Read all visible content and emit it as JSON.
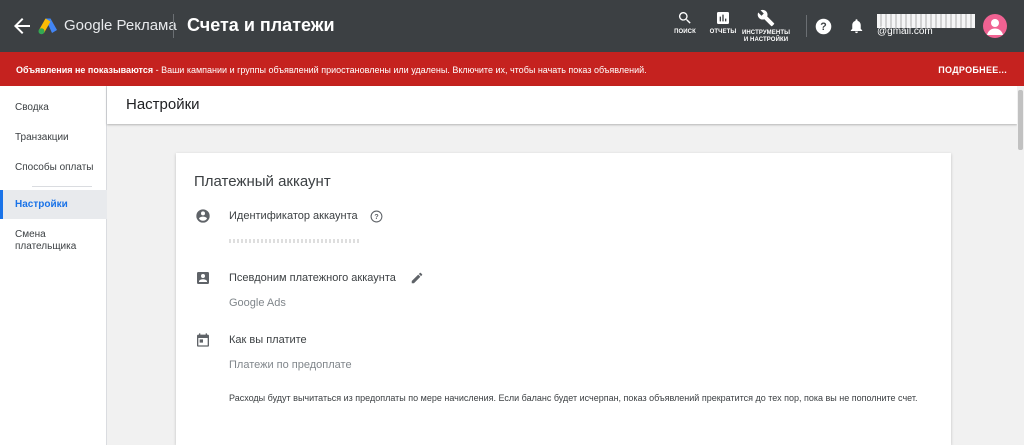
{
  "header": {
    "brand": "Google Реклама",
    "title": "Счета и платежи",
    "tools": {
      "search": "ПОИСК",
      "reports": "ОТЧЕТЫ",
      "tools_line1": "ИНСТРУМЕНТЫ",
      "tools_line2": "И НАСТРОЙКИ"
    },
    "email": "@gmail.com"
  },
  "alert": {
    "bold": "Объявления не показываются",
    "text": " - Ваши кампании и группы объявлений приостановлены или удалены. Включите их, чтобы начать показ объявлений.",
    "more": "ПОДРОБНЕЕ..."
  },
  "sidebar": {
    "items": [
      {
        "label": "Сводка"
      },
      {
        "label": "Транзакции"
      },
      {
        "label": "Способы оплаты"
      },
      {
        "label": "Настройки"
      },
      {
        "label": "Смена плательщика"
      }
    ]
  },
  "main": {
    "page_title": "Настройки",
    "card": {
      "title": "Платежный аккаунт",
      "account_id_label": "Идентификатор аккаунта",
      "alias_label": "Псевдоним платежного аккаунта",
      "alias_value": "Google Ads",
      "how_you_pay_label": "Как вы платите",
      "how_you_pay_value": "Платежи по предоплате",
      "description": "Расходы будут вычитаться из предоплаты по мере начисления. Если баланс будет исчерпан, показ объявлений прекратится до тех пор, пока вы не пополните счет."
    }
  },
  "colors": {
    "topbar": "#3c4043",
    "alert": "#c5221f",
    "accent": "#1a73e8",
    "avatar": "#f06292"
  },
  "icons": [
    "back-arrow-icon",
    "google-ads-logo-icon",
    "search-icon",
    "reports-icon",
    "wrench-icon",
    "help-icon",
    "bell-icon",
    "avatar-icon",
    "account-circle-icon",
    "help-circle-icon",
    "contact-card-icon",
    "pencil-icon",
    "calendar-icon"
  ]
}
